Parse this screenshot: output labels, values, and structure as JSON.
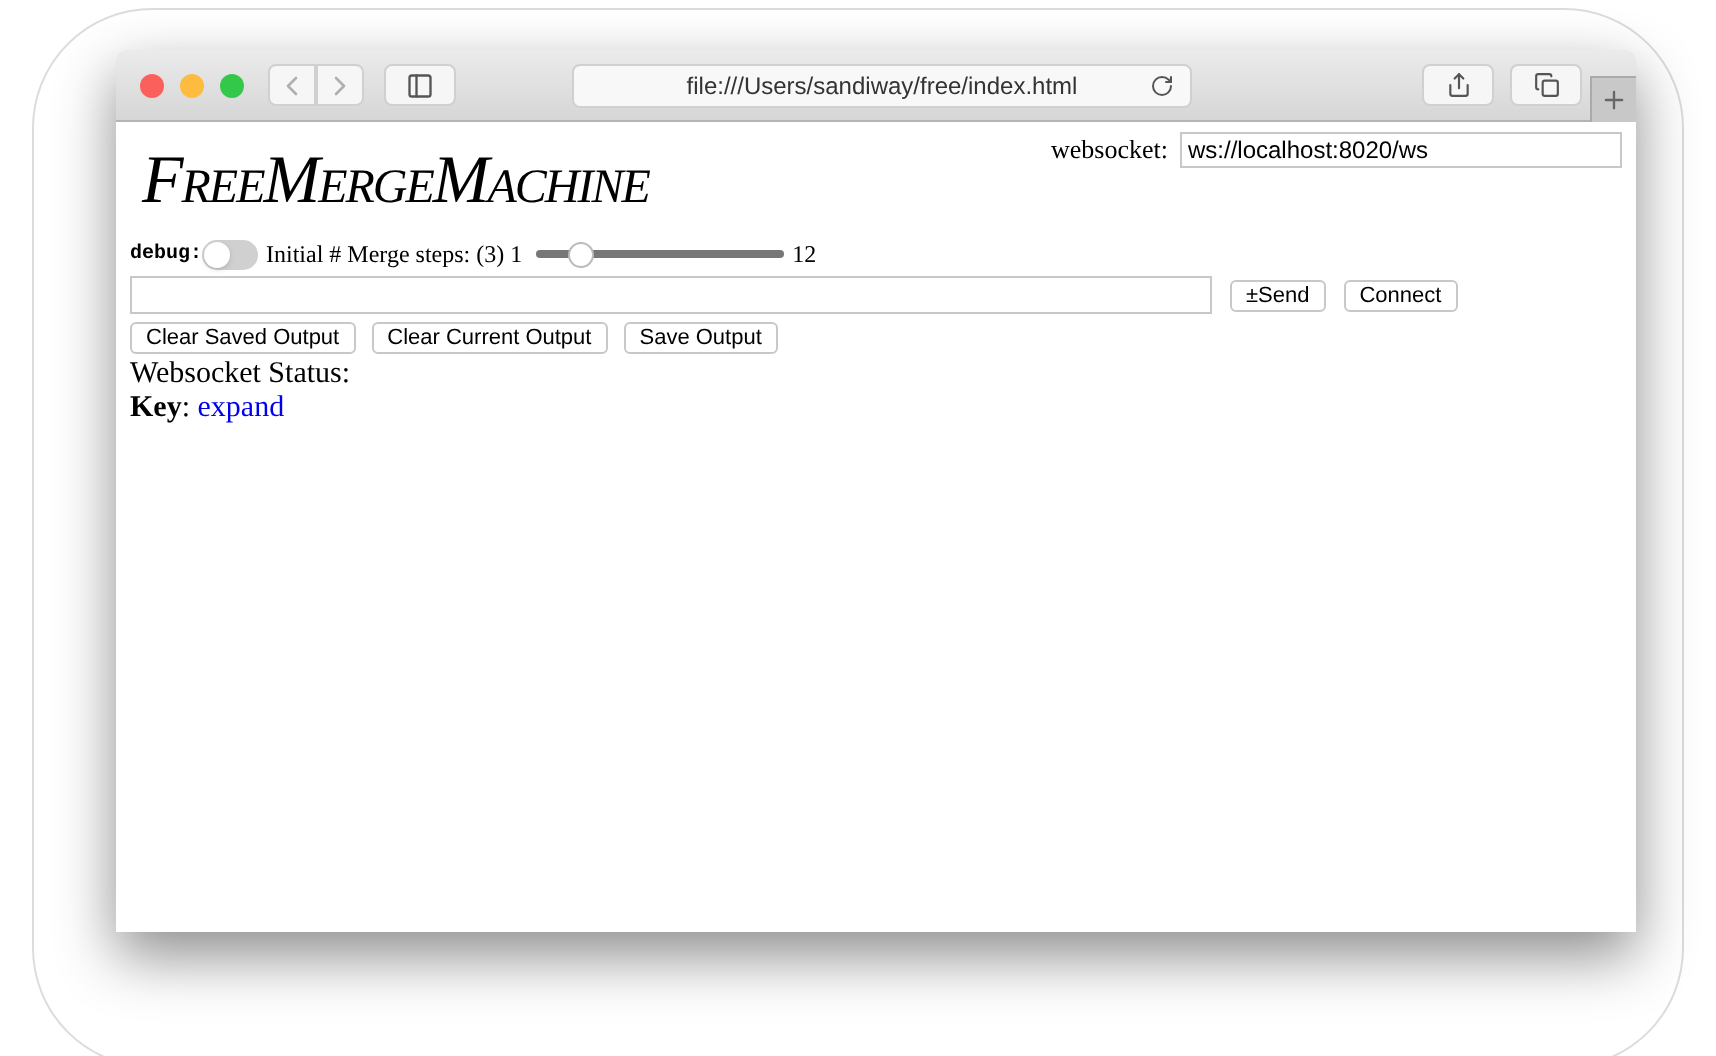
{
  "browser": {
    "url": "file:///Users/sandiway/free/index.html"
  },
  "page": {
    "logo": "FreeMergeMachine",
    "websocket": {
      "label": "websocket:",
      "value": "ws://localhost:8020/ws"
    },
    "debug": {
      "label": "debug:",
      "on": false
    },
    "merge_steps": {
      "label": "Initial # Merge steps: (3)",
      "min": "1",
      "max": "12",
      "level": 0.18
    },
    "input": {
      "send": "±Send",
      "connect": "Connect"
    },
    "buttons": [
      "Clear Saved Output",
      "Clear Current Output",
      "Save Output"
    ],
    "status": {
      "label": "Websocket Status:"
    },
    "key": {
      "label": "Key",
      "separator": ":",
      "link": "expand"
    }
  }
}
